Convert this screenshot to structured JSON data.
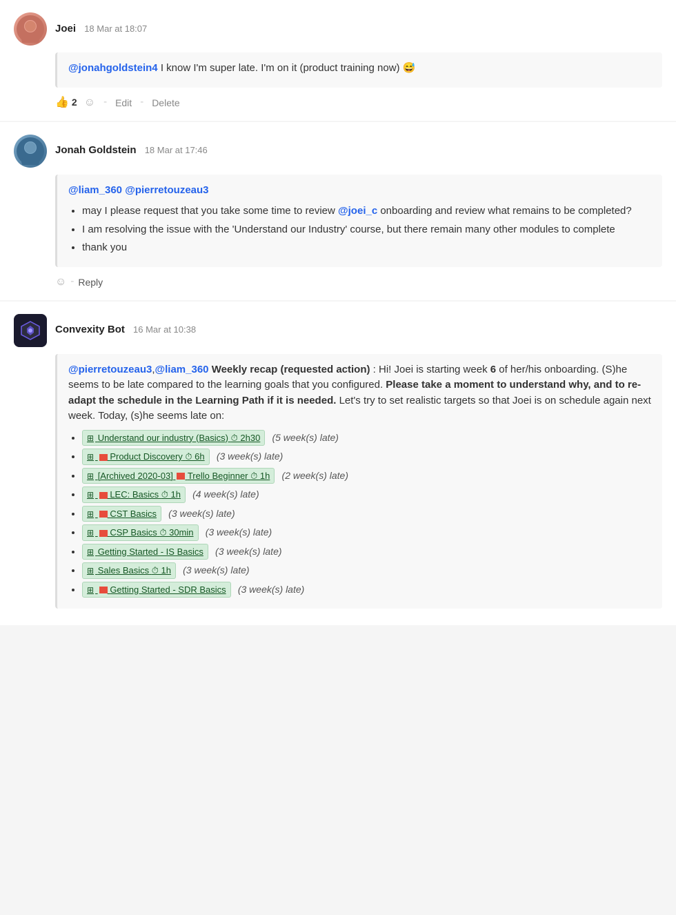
{
  "messages": [
    {
      "id": "msg1",
      "author": "Joei",
      "timestamp": "18 Mar at 18:07",
      "avatar_type": "joei",
      "content": {
        "text": "@jonahgoldstein4 I know I'm super late. I'm on it (product training now) 😅",
        "mention": "@jonahgoldstein4",
        "after_mention": " I know I'm super late. I'm on it (product training now) 😅"
      },
      "reactions": [
        {
          "emoji": "👍",
          "count": "2"
        }
      ],
      "actions": [
        "Edit",
        "Delete"
      ]
    },
    {
      "id": "msg2",
      "author": "Jonah Goldstein",
      "timestamp": "18 Mar at 17:46",
      "avatar_type": "jonah",
      "content": {
        "mentions_header": "@liam_360 @pierretouzeau3",
        "bullets": [
          "may I please request that you take some time to review @joei_c onboarding and review what remains to be completed?",
          "I am resolving the issue with the 'Understand our Industry' course, but there remain many other modules to complete",
          "thank you"
        ]
      },
      "actions": [
        "Reply"
      ]
    },
    {
      "id": "msg3",
      "author": "Convexity Bot",
      "timestamp": "16 Mar at 10:38",
      "avatar_type": "bot",
      "content": {
        "intro": "@pierretouzeau3,@liam_360 Weekly recap (requested action): Hi! Joei is starting week 6 of her/his onboarding. (S)he seems to be late compared to the learning goals that you configured. Please take a moment to understand why, and to re-adapt the schedule in the Learning Path if it is needed. Let's try to set realistic targets so that Joei is on schedule again next week. Today, (s)he seems late on:",
        "intro_mention1": "@pierretouzeau3",
        "intro_mention2": "@liam_360",
        "intro_bold_week": "6",
        "intro_bold_sentence": "Please take a moment to understand why, and to re-adapt the schedule in the Learning Path if it is needed.",
        "courses": [
          {
            "name": "Understand our industry (Basics)",
            "duration": "⏱ 2h30",
            "late": "(5 week(s) late)",
            "has_flag": false,
            "archived": false
          },
          {
            "name": "Product Discovery",
            "duration": "⏱ 6h",
            "late": "(3 week(s) late)",
            "has_flag": true,
            "archived": false
          },
          {
            "name": "[Archived 2020-03]",
            "name2": "Trello Beginner",
            "duration": "⏱ 1h",
            "late": "(2 week(s) late)",
            "has_flag": true,
            "archived": true
          },
          {
            "name": "LEC: Basics",
            "duration": "⏱ 1h",
            "late": "(4 week(s) late)",
            "has_flag": true,
            "archived": false
          },
          {
            "name": "CST Basics",
            "duration": "",
            "late": "(3 week(s) late)",
            "has_flag": true,
            "archived": false
          },
          {
            "name": "CSP Basics",
            "duration": "⏱ 30min",
            "late": "(3 week(s) late)",
            "has_flag": true,
            "archived": false
          },
          {
            "name": "Getting Started - IS Basics",
            "duration": "",
            "late": "(3 week(s) late)",
            "has_flag": false,
            "archived": false
          },
          {
            "name": "Sales Basics",
            "duration": "⏱ 1h",
            "late": "(3 week(s) late)",
            "has_flag": false,
            "archived": false
          },
          {
            "name": "Getting Started - SDR Basics",
            "duration": "",
            "late": "(3 week(s) late)",
            "has_flag": true,
            "archived": false
          }
        ]
      }
    }
  ],
  "labels": {
    "edit": "Edit",
    "delete": "Delete",
    "reply": "Reply",
    "emoji_smile": "☺"
  }
}
